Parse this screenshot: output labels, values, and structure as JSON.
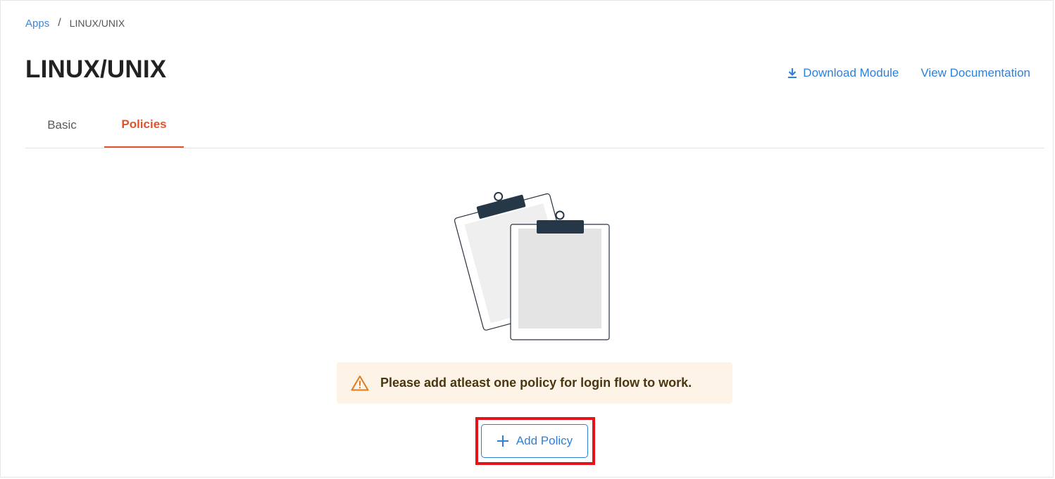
{
  "breadcrumb": {
    "root": "Apps",
    "separator": "/",
    "current": "LINUX/UNIX"
  },
  "page": {
    "title": "LINUX/UNIX"
  },
  "actions": {
    "download_label": "Download Module",
    "docs_label": "View Documentation"
  },
  "tabs": [
    {
      "label": "Basic",
      "active": false
    },
    {
      "label": "Policies",
      "active": true
    }
  ],
  "empty_state": {
    "illustration": "clipboards-illustration",
    "warning_icon": "warning-triangle-icon",
    "message": "Please add atleast one policy for login flow to work."
  },
  "add_button": {
    "label": "Add Policy",
    "icon": "plus-icon",
    "highlighted": true
  },
  "colors": {
    "link": "#2f80d8",
    "active_tab": "#e0542b",
    "alert_bg": "#fdf3e6",
    "warning": "#e07b1f",
    "highlight": "#e5141a"
  }
}
